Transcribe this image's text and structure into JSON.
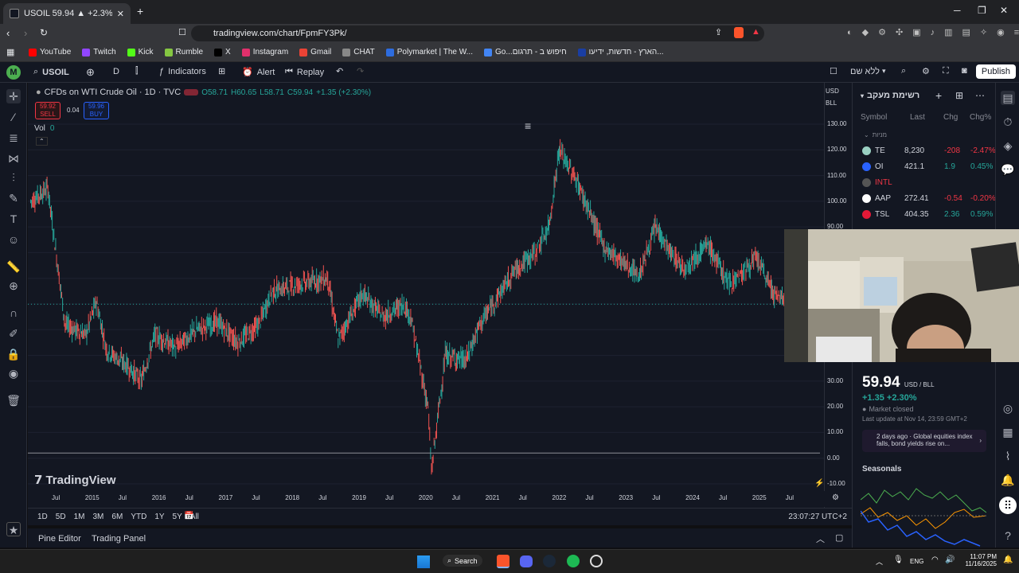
{
  "browser": {
    "tab_title": "USOIL 59.94 ▲ +2.3% ללא שם",
    "url": "tradingview.com/chart/FpmFY3Pk/",
    "bookmarks": [
      {
        "label": "YouTube",
        "color": "#ff0000"
      },
      {
        "label": "Twitch",
        "color": "#9146ff"
      },
      {
        "label": "Kick",
        "color": "#53fc18"
      },
      {
        "label": "Rumble",
        "color": "#85c742"
      },
      {
        "label": "X",
        "color": "#000000"
      },
      {
        "label": "Instagram",
        "color": "#e1306c"
      },
      {
        "label": "Gmail",
        "color": "#ea4335"
      },
      {
        "label": "CHAT",
        "color": "#888888"
      },
      {
        "label": "Polymarket | The W...",
        "color": "#2d6cdf"
      },
      {
        "label": "Go...חיפוש ב - תרגום",
        "color": "#4285f4"
      },
      {
        "label": "הארץ - חדשות, ידיעו...",
        "color": "#1a3ea3"
      }
    ]
  },
  "toolbar": {
    "symbol": "USOIL",
    "interval": "D",
    "indicators": "Indicators",
    "alert": "Alert",
    "replay": "Replay",
    "layout_name": "ללא שם",
    "publish": "Publish"
  },
  "legend": {
    "title": "CFDs on WTI Crude Oil · 1D · TVC",
    "open": "O58.71",
    "high": "H60.65",
    "low": "L58.71",
    "close": "C59.94",
    "change": "+1.35 (+2.30%)",
    "sell_price": "59.92",
    "sell_label": "SELL",
    "spread": "0.04",
    "buy_price": "59.96",
    "buy_label": "BUY",
    "vol_label": "Vol",
    "vol_value": "0"
  },
  "currency": "USD",
  "unit": "BLL",
  "brand": "TradingView",
  "chart_data": {
    "type": "line",
    "price_ticks": [
      "130.00",
      "120.00",
      "110.00",
      "100.00",
      "90.00",
      "80.00",
      "70.00",
      "60.00",
      "50.00",
      "40.00",
      "30.00",
      "20.00",
      "10.00",
      "0.00",
      "-10.00"
    ],
    "time_labels": [
      "Jul",
      "2015",
      "Jul",
      "2016",
      "Jul",
      "2017",
      "Jul",
      "2018",
      "Jul",
      "2019",
      "Jul",
      "2020",
      "Jul",
      "2021",
      "Jul",
      "2022",
      "Jul",
      "2023",
      "Jul",
      "2024",
      "Jul",
      "2025",
      "Jul"
    ],
    "x": [
      2014.5,
      2014.75,
      2015.0,
      2015.3,
      2015.45,
      2015.6,
      2015.9,
      2016.1,
      2016.3,
      2016.6,
      2016.9,
      2017.2,
      2017.5,
      2017.8,
      2018.0,
      2018.4,
      2018.8,
      2018.95,
      2019.3,
      2019.6,
      2019.9,
      2020.0,
      2020.25,
      2020.3,
      2020.5,
      2020.8,
      2021.0,
      2021.5,
      2021.8,
      2022.0,
      2022.15,
      2022.4,
      2022.6,
      2022.8,
      2023.0,
      2023.3,
      2023.55,
      2023.75,
      2023.95,
      2024.3,
      2024.6,
      2024.8,
      2025.0,
      2025.3,
      2025.6,
      2025.87
    ],
    "y": [
      100,
      105,
      52,
      48,
      61,
      42,
      36,
      30,
      48,
      43,
      50,
      53,
      45,
      52,
      65,
      68,
      70,
      46,
      64,
      55,
      60,
      55,
      20,
      -5,
      40,
      38,
      52,
      73,
      80,
      90,
      120,
      108,
      95,
      82,
      78,
      71,
      90,
      80,
      74,
      83,
      68,
      72,
      78,
      62,
      66,
      60
    ],
    "ylim": [
      -10,
      130
    ],
    "current_price": 59.94
  },
  "bottom": {
    "ranges": [
      "1D",
      "5D",
      "1M",
      "3M",
      "6M",
      "YTD",
      "1Y",
      "5Y",
      "All"
    ],
    "clock": "23:07:27 UTC+2",
    "pine_editor": "Pine Editor",
    "trading_panel": "Trading Panel"
  },
  "watchlist": {
    "title": "רשימת מעקב",
    "col_symbol": "Symbol",
    "col_last": "Last",
    "col_chg": "Chg",
    "col_chgp": "Chg%",
    "group": "מניות",
    "rows": [
      {
        "symbol": "TE",
        "last": "8,230",
        "chg": "-208",
        "chgp": "-2.47%",
        "dir": "neg",
        "color": "#9ad0c2"
      },
      {
        "symbol": "OI",
        "last": "421.1",
        "chg": "1.9",
        "chgp": "0.45%",
        "dir": "pos",
        "color": "#2962ff"
      },
      {
        "symbol": "INTL",
        "last": "",
        "chg": "",
        "chgp": "",
        "dir": "neg",
        "color": "#555555"
      },
      {
        "symbol": "AAP",
        "last": "272.41",
        "chg": "-0.54",
        "chgp": "-0.20%",
        "dir": "neg",
        "color": "#ffffff"
      },
      {
        "symbol": "TSL",
        "last": "404.35",
        "chg": "2.36",
        "chgp": "0.59%",
        "dir": "pos",
        "color": "#e31937"
      }
    ]
  },
  "detail": {
    "price": "59.94",
    "unit": "USD / BLL",
    "change": "+1.35  +2.30%",
    "status": "Market closed",
    "updated": "Last update at Nov 14, 23:59 GMT+2",
    "news": "2 days ago · Global equities index falls, bond yields rise on...",
    "seasonals": "Seasonals"
  },
  "taskbar": {
    "search": "Search",
    "lang": "ENG",
    "time": "11:07 PM",
    "date": "11/16/2025"
  }
}
